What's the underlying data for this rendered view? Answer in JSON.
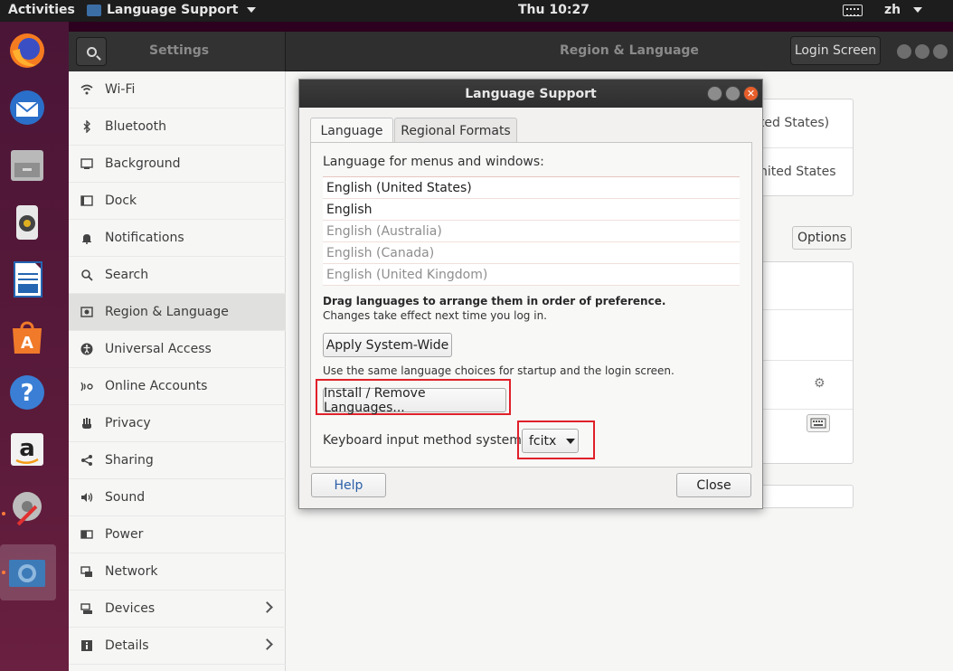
{
  "topbar": {
    "activities": "Activities",
    "app_name": "Language Support",
    "clock": "Thu 10:27",
    "input_lang": "zh"
  },
  "dock": {
    "items": [
      "firefox-icon",
      "thunderbird-icon",
      "files-icon",
      "rhythmbox-icon",
      "libreoffice-writer-icon",
      "software-center-icon",
      "help-icon",
      "amazon-icon",
      "system-tools-icon",
      "language-support-icon"
    ]
  },
  "settings": {
    "search_title": "Settings",
    "page_title": "Region & Language",
    "login_screen_label": "Login Screen",
    "sidebar": [
      {
        "label": "Wi-Fi",
        "icon": "wifi-icon"
      },
      {
        "label": "Bluetooth",
        "icon": "bluetooth-icon"
      },
      {
        "label": "Background",
        "icon": "background-icon"
      },
      {
        "label": "Dock",
        "icon": "dock-icon"
      },
      {
        "label": "Notifications",
        "icon": "bell-icon"
      },
      {
        "label": "Search",
        "icon": "search-icon"
      },
      {
        "label": "Region & Language",
        "icon": "region-icon"
      },
      {
        "label": "Universal Access",
        "icon": "accessibility-icon"
      },
      {
        "label": "Online Accounts",
        "icon": "online-accounts-icon"
      },
      {
        "label": "Privacy",
        "icon": "hand-icon"
      },
      {
        "label": "Sharing",
        "icon": "share-icon"
      },
      {
        "label": "Sound",
        "icon": "speaker-icon"
      },
      {
        "label": "Power",
        "icon": "power-icon"
      },
      {
        "label": "Network",
        "icon": "network-icon"
      },
      {
        "label": "Devices",
        "icon": "devices-icon"
      },
      {
        "label": "Details",
        "icon": "info-icon"
      }
    ],
    "main": {
      "language_value": "ited States)",
      "formats_value": "nited States",
      "options_label": "Options"
    }
  },
  "dialog": {
    "title": "Language Support",
    "tabs": [
      "Language",
      "Regional Formats"
    ],
    "menus_label": "Language for menus and windows:",
    "languages": [
      {
        "name": "English (United States)",
        "enabled": true
      },
      {
        "name": "English",
        "enabled": true
      },
      {
        "name": "English (Australia)",
        "enabled": false
      },
      {
        "name": "English (Canada)",
        "enabled": false
      },
      {
        "name": "English (United Kingdom)",
        "enabled": false
      }
    ],
    "drag_bold": "Drag languages to arrange them in order of preference.",
    "drag_note": "Changes take effect next time you log in.",
    "apply_label": "Apply System-Wide",
    "same_lang_note": "Use the same language choices for startup and the login screen.",
    "install_label": "Install / Remove Languages...",
    "keyboard_label": "Keyboard input method system:",
    "keyboard_value": "fcitx",
    "help_label": "Help",
    "close_label": "Close"
  },
  "colors": {
    "highlight": "#e0202a",
    "close_button": "#e75e2a",
    "topbar": "#1d1d1d"
  }
}
